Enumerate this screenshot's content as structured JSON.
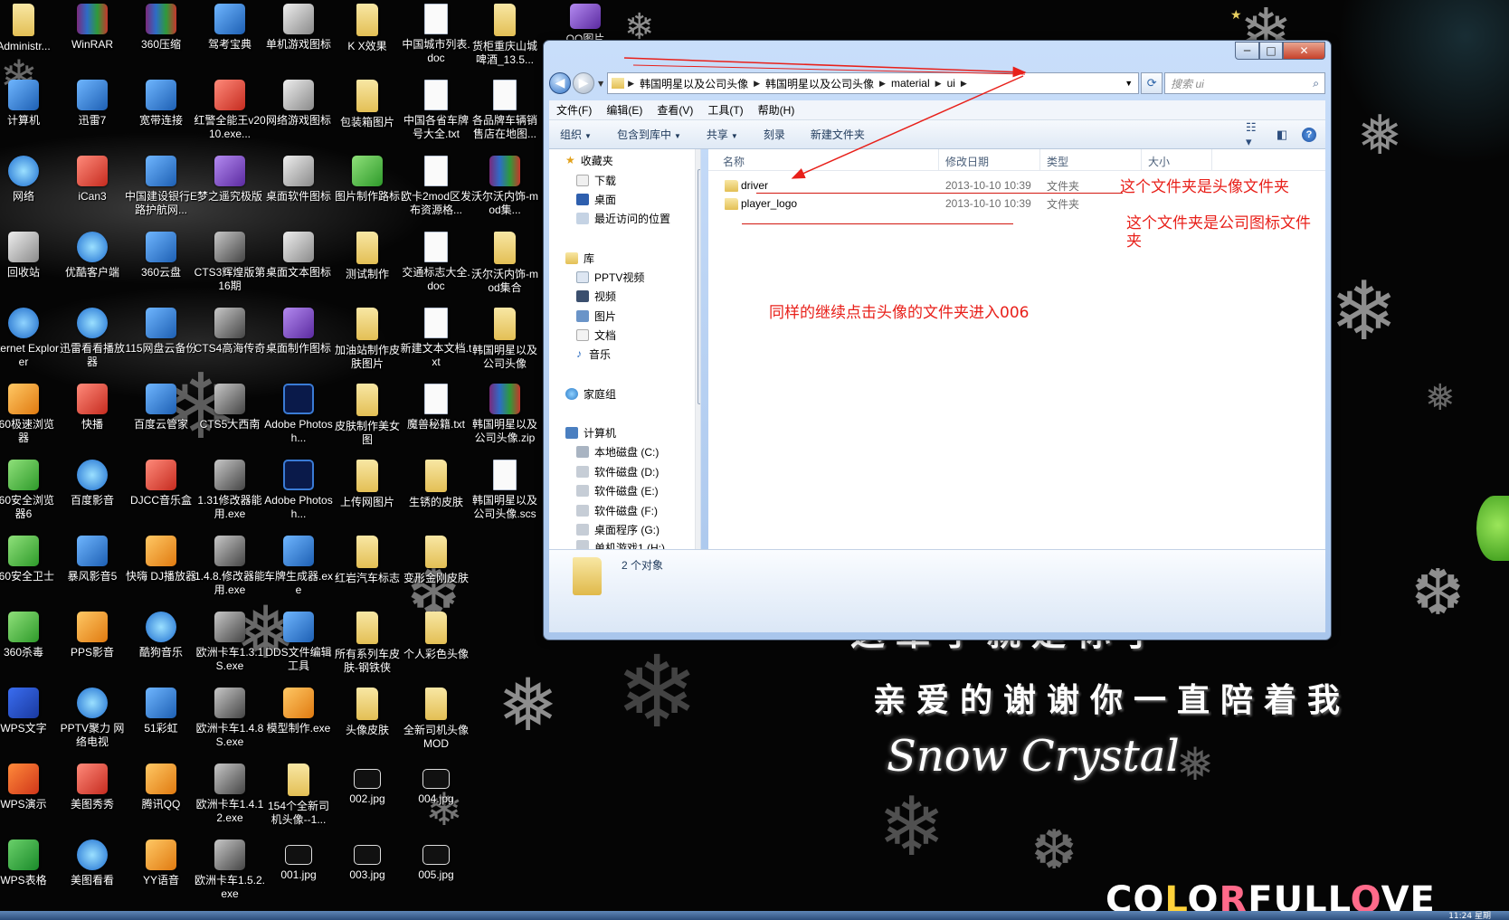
{
  "desktop": {
    "icons": [
      {
        "label": "Administr...",
        "icon": "folder-user",
        "style": "folder",
        "col": 0,
        "row": 0
      },
      {
        "label": "WinRAR",
        "icon": "winrar",
        "style": "rar",
        "col": 1,
        "row": 0
      },
      {
        "label": "360压缩",
        "icon": "archive",
        "style": "rar",
        "col": 2,
        "row": 0
      },
      {
        "label": "驾考宝典",
        "icon": "car",
        "style": "app",
        "col": 3,
        "row": 0
      },
      {
        "label": "单机游戏图标",
        "icon": "drive",
        "style": "gray",
        "col": 4,
        "row": 0
      },
      {
        "label": "K X效果",
        "icon": "folder",
        "style": "folder",
        "col": 5,
        "row": 0
      },
      {
        "label": "中国城市列表.doc",
        "icon": "word-doc",
        "style": "doc",
        "col": 6,
        "row": 0
      },
      {
        "label": "货柜重庆山城啤酒_13.5...",
        "icon": "folder",
        "style": "folder",
        "col": 7,
        "row": 0
      },
      {
        "label": "计算机",
        "icon": "computer",
        "style": "app",
        "col": 0,
        "row": 1
      },
      {
        "label": "迅雷7",
        "icon": "thunder",
        "style": "app",
        "col": 1,
        "row": 1
      },
      {
        "label": "宽带连接",
        "icon": "network",
        "style": "app",
        "col": 2,
        "row": 1
      },
      {
        "label": "红警全能王v2010.exe...",
        "icon": "game",
        "style": "red",
        "col": 3,
        "row": 1
      },
      {
        "label": "网络游戏图标",
        "icon": "drive",
        "style": "gray",
        "col": 4,
        "row": 1
      },
      {
        "label": "包装箱图片",
        "icon": "folder",
        "style": "folder",
        "col": 5,
        "row": 1
      },
      {
        "label": "中国各省车牌号大全.txt",
        "icon": "text-doc",
        "style": "doc",
        "col": 6,
        "row": 1
      },
      {
        "label": "各品牌车辆销售店在地图...",
        "icon": "wps-doc",
        "style": "doc",
        "col": 7,
        "row": 1
      },
      {
        "label": "网络",
        "icon": "network",
        "style": "blue-round",
        "col": 0,
        "row": 2
      },
      {
        "label": "iCan3",
        "icon": "app",
        "style": "red",
        "col": 1,
        "row": 2
      },
      {
        "label": "中国建设银行E路护航网...",
        "icon": "bank",
        "style": "app",
        "col": 2,
        "row": 2
      },
      {
        "label": "梦之遥究极版",
        "icon": "game",
        "style": "purple",
        "col": 3,
        "row": 2
      },
      {
        "label": "桌面软件图标",
        "icon": "drive",
        "style": "gray",
        "col": 4,
        "row": 2
      },
      {
        "label": "图片制作路标",
        "icon": "folder",
        "style": "green",
        "col": 5,
        "row": 2
      },
      {
        "label": "欧卡2mod区发布资源格...",
        "icon": "text-doc",
        "style": "doc",
        "col": 6,
        "row": 2
      },
      {
        "label": "沃尔沃内饰-mod集...",
        "icon": "archive",
        "style": "rar",
        "col": 7,
        "row": 2
      },
      {
        "label": "回收站",
        "icon": "recycle-bin",
        "style": "gray",
        "col": 0,
        "row": 3
      },
      {
        "label": "优酷客户端",
        "icon": "youku",
        "style": "blue-round",
        "col": 1,
        "row": 3
      },
      {
        "label": "360云盘",
        "icon": "cloud",
        "style": "app",
        "col": 2,
        "row": 3
      },
      {
        "label": "CTS3辉煌版第16期",
        "icon": "truck",
        "style": "truck",
        "col": 3,
        "row": 3
      },
      {
        "label": "桌面文本图标",
        "icon": "drive",
        "style": "gray",
        "col": 4,
        "row": 3
      },
      {
        "label": "测试制作",
        "icon": "folder",
        "style": "folder",
        "col": 5,
        "row": 3
      },
      {
        "label": "交通标志大全.doc",
        "icon": "word-doc",
        "style": "doc",
        "col": 6,
        "row": 3
      },
      {
        "label": "沃尔沃内饰-mod集合",
        "icon": "folder",
        "style": "folder",
        "col": 7,
        "row": 3
      },
      {
        "label": "Internet Explorer",
        "icon": "ie",
        "style": "ie",
        "col": 0,
        "row": 4
      },
      {
        "label": "迅雷看看播放器",
        "icon": "player",
        "style": "blue-round",
        "col": 1,
        "row": 4
      },
      {
        "label": "115网盘云备份",
        "icon": "cloud",
        "style": "app",
        "col": 2,
        "row": 4
      },
      {
        "label": "CTS4高海传奇",
        "icon": "truck",
        "style": "truck",
        "col": 3,
        "row": 4
      },
      {
        "label": "桌面制作图标",
        "icon": "cubes",
        "style": "purple",
        "col": 4,
        "row": 4
      },
      {
        "label": "加油站制作皮肤图片",
        "icon": "folder",
        "style": "folder",
        "col": 5,
        "row": 4
      },
      {
        "label": "新建文本文档.txt",
        "icon": "text-doc",
        "style": "doc",
        "col": 6,
        "row": 4
      },
      {
        "label": "韩国明星以及公司头像",
        "icon": "folder",
        "style": "folder",
        "col": 7,
        "row": 4
      },
      {
        "label": "360极速浏览器",
        "icon": "browser",
        "style": "orange",
        "col": 0,
        "row": 5
      },
      {
        "label": "快播",
        "icon": "qvod",
        "style": "red",
        "col": 1,
        "row": 5
      },
      {
        "label": "百度云管家",
        "icon": "cloud",
        "style": "app",
        "col": 2,
        "row": 5
      },
      {
        "label": "CTS5大西南",
        "icon": "truck",
        "style": "truck",
        "col": 3,
        "row": 5
      },
      {
        "label": "Adobe Photosh...",
        "icon": "photoshop",
        "style": "ps",
        "col": 4,
        "row": 5
      },
      {
        "label": "皮肤制作美女图",
        "icon": "folder",
        "style": "folder",
        "col": 5,
        "row": 5
      },
      {
        "label": "魔兽秘籍.txt",
        "icon": "text-doc",
        "style": "doc",
        "col": 6,
        "row": 5
      },
      {
        "label": "韩国明星以及公司头像.zip",
        "icon": "archive",
        "style": "rar",
        "col": 7,
        "row": 5
      },
      {
        "label": "360安全浏览器6",
        "icon": "browser",
        "style": "green",
        "col": 0,
        "row": 6
      },
      {
        "label": "百度影音",
        "icon": "player",
        "style": "blue-round",
        "col": 1,
        "row": 6
      },
      {
        "label": "DJCC音乐盒",
        "icon": "music",
        "style": "red",
        "col": 2,
        "row": 6
      },
      {
        "label": "1.31修改器能用.exe",
        "icon": "truck",
        "style": "truck",
        "col": 3,
        "row": 6
      },
      {
        "label": "Adobe Photosh...",
        "icon": "photoshop",
        "style": "ps",
        "col": 4,
        "row": 6
      },
      {
        "label": "上传网图片",
        "icon": "folder",
        "style": "folder",
        "col": 5,
        "row": 6
      },
      {
        "label": "生锈的皮肤",
        "icon": "folder",
        "style": "folder",
        "col": 6,
        "row": 6
      },
      {
        "label": "韩国明星以及公司头像.scs",
        "icon": "file",
        "style": "doc",
        "col": 7,
        "row": 6
      },
      {
        "label": "360安全卫士",
        "icon": "shield",
        "style": "green",
        "col": 0,
        "row": 7
      },
      {
        "label": "暴风影音5",
        "icon": "player",
        "style": "app",
        "col": 1,
        "row": 7
      },
      {
        "label": "快嗨 DJ播放器",
        "icon": "music",
        "style": "orange",
        "col": 2,
        "row": 7
      },
      {
        "label": "1.4.8.修改器能用.exe",
        "icon": "truck",
        "style": "truck",
        "col": 3,
        "row": 7
      },
      {
        "label": "车牌生成器.exe",
        "icon": "app",
        "style": "app",
        "col": 4,
        "row": 7
      },
      {
        "label": "红岩汽车标志",
        "icon": "folder",
        "style": "folder",
        "col": 5,
        "row": 7
      },
      {
        "label": "变形金刚皮肤",
        "icon": "folder",
        "style": "folder",
        "col": 6,
        "row": 7
      },
      {
        "label": "360杀毒",
        "icon": "shield",
        "style": "green",
        "col": 0,
        "row": 8
      },
      {
        "label": "PPS影音",
        "icon": "player",
        "style": "orange",
        "col": 1,
        "row": 8
      },
      {
        "label": "酷狗音乐",
        "icon": "music",
        "style": "blue-round",
        "col": 2,
        "row": 8
      },
      {
        "label": "欧洲卡车1.3.1S.exe",
        "icon": "truck",
        "style": "truck",
        "col": 3,
        "row": 8
      },
      {
        "label": "DDS文件编辑工具",
        "icon": "tool",
        "style": "app",
        "col": 4,
        "row": 8
      },
      {
        "label": "所有系列车皮肤-钢铁侠",
        "icon": "folder",
        "style": "folder",
        "col": 5,
        "row": 8
      },
      {
        "label": "个人彩色头像",
        "icon": "folder",
        "style": "folder",
        "col": 6,
        "row": 8
      },
      {
        "label": "WPS文字",
        "icon": "wps-writer",
        "style": "wps",
        "col": 0,
        "row": 9
      },
      {
        "label": "PPTV聚力 网络电视",
        "icon": "pptv",
        "style": "blue-round",
        "col": 1,
        "row": 9
      },
      {
        "label": "51彩虹",
        "icon": "app",
        "style": "app",
        "col": 2,
        "row": 9
      },
      {
        "label": "欧洲卡车1.4.8S.exe",
        "icon": "truck",
        "style": "truck",
        "col": 3,
        "row": 9
      },
      {
        "label": "模型制作.exe",
        "icon": "app",
        "style": "orange",
        "col": 4,
        "row": 9
      },
      {
        "label": "头像皮肤",
        "icon": "folder",
        "style": "folder",
        "col": 5,
        "row": 9
      },
      {
        "label": "全新司机头像MOD",
        "icon": "folder",
        "style": "folder",
        "col": 6,
        "row": 9
      },
      {
        "label": "WPS演示",
        "icon": "wps-presentation",
        "style": "wpsr",
        "col": 0,
        "row": 10
      },
      {
        "label": "美图秀秀",
        "icon": "meitu",
        "style": "red",
        "col": 1,
        "row": 10
      },
      {
        "label": "腾讯QQ",
        "icon": "qq",
        "style": "orange",
        "col": 2,
        "row": 10
      },
      {
        "label": "欧洲卡车1.4.12.exe",
        "icon": "truck",
        "style": "truck",
        "col": 3,
        "row": 10
      },
      {
        "label": "154个全新司机头像--1...",
        "icon": "folder",
        "style": "folder",
        "col": 4,
        "row": 10
      },
      {
        "label": "002.jpg",
        "icon": "image",
        "style": "jpg",
        "col": 5,
        "row": 10
      },
      {
        "label": "004.jpg",
        "icon": "image",
        "style": "jpg",
        "col": 6,
        "row": 10
      },
      {
        "label": "WPS表格",
        "icon": "wps-spreadsheet",
        "style": "wpsg",
        "col": 0,
        "row": 11
      },
      {
        "label": "美图看看",
        "icon": "meitu",
        "style": "blue-round",
        "col": 1,
        "row": 11
      },
      {
        "label": "YY语音",
        "icon": "yy",
        "style": "orange",
        "col": 2,
        "row": 11
      },
      {
        "label": "欧洲卡车1.5.2.exe",
        "icon": "truck",
        "style": "truck",
        "col": 3,
        "row": 11
      },
      {
        "label": "001.jpg",
        "icon": "image",
        "style": "jpg",
        "col": 4,
        "row": 11
      },
      {
        "label": "003.jpg",
        "icon": "image",
        "style": "jpg",
        "col": 5,
        "row": 11
      },
      {
        "label": "005.jpg",
        "icon": "image",
        "style": "jpg",
        "col": 6,
        "row": 11
      }
    ],
    "partial_icon_label": "QQ图片",
    "wallpaper": {
      "line1": "这辈子就是你了",
      "line2": "亲爱的谢谢你一直陪着我",
      "script": "Snow Crystal",
      "brand": "COLORFULLOVE"
    },
    "clock_partial": "11:24 星期"
  },
  "explorer": {
    "controls": {
      "minimize": "─",
      "maximize": "□",
      "close": "✕"
    },
    "breadcrumb": [
      "韩国明星以及公司头像",
      "韩国明星以及公司头像",
      "material",
      "ui"
    ],
    "search_placeholder": "搜索 ui",
    "menu": [
      "文件(F)",
      "编辑(E)",
      "查看(V)",
      "工具(T)",
      "帮助(H)"
    ],
    "toolbar": {
      "organize": "组织",
      "include_in_library": "包含到库中",
      "share": "共享",
      "burn": "刻录",
      "new_folder": "新建文件夹"
    },
    "nav": {
      "favorites": "收藏夹",
      "favorites_items": [
        "下载",
        "桌面",
        "最近访问的位置"
      ],
      "libraries": "库",
      "libraries_items": [
        "PPTV视频",
        "视频",
        "图片",
        "文档",
        "音乐"
      ],
      "homegroup": "家庭组",
      "computer": "计算机",
      "drives": [
        "本地磁盘 (C:)",
        "软件磁盘 (D:)",
        "软件磁盘 (E:)",
        "软件磁盘 (F:)",
        "桌面程序 (G:)",
        "单机游戏1 (H:)"
      ]
    },
    "columns": [
      "名称",
      "修改日期",
      "类型",
      "大小"
    ],
    "files": [
      {
        "name": "driver",
        "modified": "2013-10-10 10:39",
        "type": "文件夹"
      },
      {
        "name": "player_logo",
        "modified": "2013-10-10 10:39",
        "type": "文件夹"
      }
    ],
    "status": "2 个对象"
  },
  "annotations": {
    "driver_note": "这个文件夹是头像文件夹",
    "player_logo_note": "这个文件夹是公司图标文件夹",
    "instruction": "同样的继续点击头像的文件夹进入006"
  },
  "colors": {
    "annotation_red": "#e8201a",
    "window_frame": "#b9d1f0",
    "close_red": "#c7412a"
  }
}
